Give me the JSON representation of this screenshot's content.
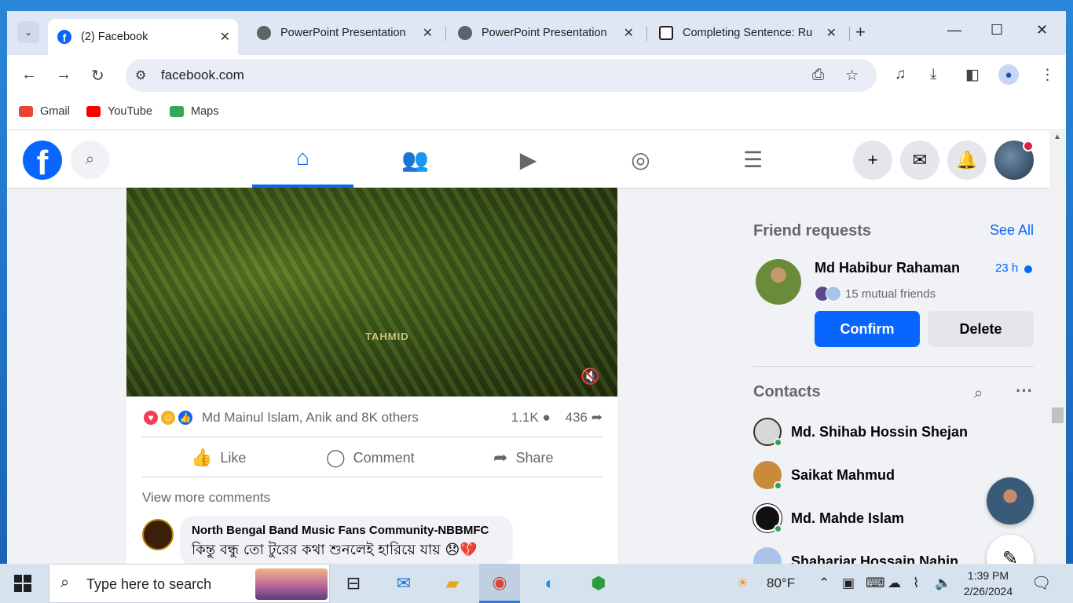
{
  "browser": {
    "tabs": [
      {
        "title": "(2) Facebook",
        "favicon_color": "#0866ff"
      },
      {
        "title": "PowerPoint Presentation",
        "favicon_color": "#5f6368"
      },
      {
        "title": "PowerPoint Presentation",
        "favicon_color": "#5f6368"
      },
      {
        "title": "Completing Sentence: Ru",
        "favicon_color": "#1f1f1f"
      }
    ],
    "url": "facebook.com",
    "bookmarks": [
      {
        "label": "Gmail",
        "color": "#ea4335"
      },
      {
        "label": "YouTube",
        "color": "#ff0000"
      },
      {
        "label": "Maps",
        "color": "#34a853"
      }
    ]
  },
  "post": {
    "watermark": "TAHMID",
    "reactions_names": "Md Mainul Islam, Anik and 8K others",
    "comment_count": "1.1K",
    "share_count": "436",
    "actions": {
      "like": "Like",
      "comment": "Comment",
      "share": "Share"
    },
    "view_more_comments": "View more comments",
    "comment": {
      "author": "North Bengal Band Music Fans Community-NBBMFC",
      "text": "কিন্তু বন্ধু তো টুরের কথা শুনলেই হারিয়ে যায় 😞💔"
    }
  },
  "friend_requests": {
    "title": "Friend requests",
    "see_all": "See All",
    "request": {
      "name": "Md Habibur Rahaman",
      "time": "23 h",
      "mutual": "15 mutual friends",
      "confirm": "Confirm",
      "delete": "Delete"
    }
  },
  "contacts": {
    "title": "Contacts",
    "items": [
      {
        "name": "Md. Shihab Hossin Shejan",
        "color": "#d8d8d8"
      },
      {
        "name": "Saikat Mahmud",
        "color": "#c98a3a"
      },
      {
        "name": "Md. Mahde Islam",
        "color": "#111111"
      },
      {
        "name": "Shahariar Hossain Nahin",
        "color": "#a9c4e8"
      }
    ]
  },
  "taskbar": {
    "search_placeholder": "Type here to search",
    "weather": "80°F",
    "time": "1:39 PM",
    "date": "2/26/2024"
  },
  "colors": {
    "fb_blue": "#0866ff",
    "online_green": "#31a24c"
  }
}
